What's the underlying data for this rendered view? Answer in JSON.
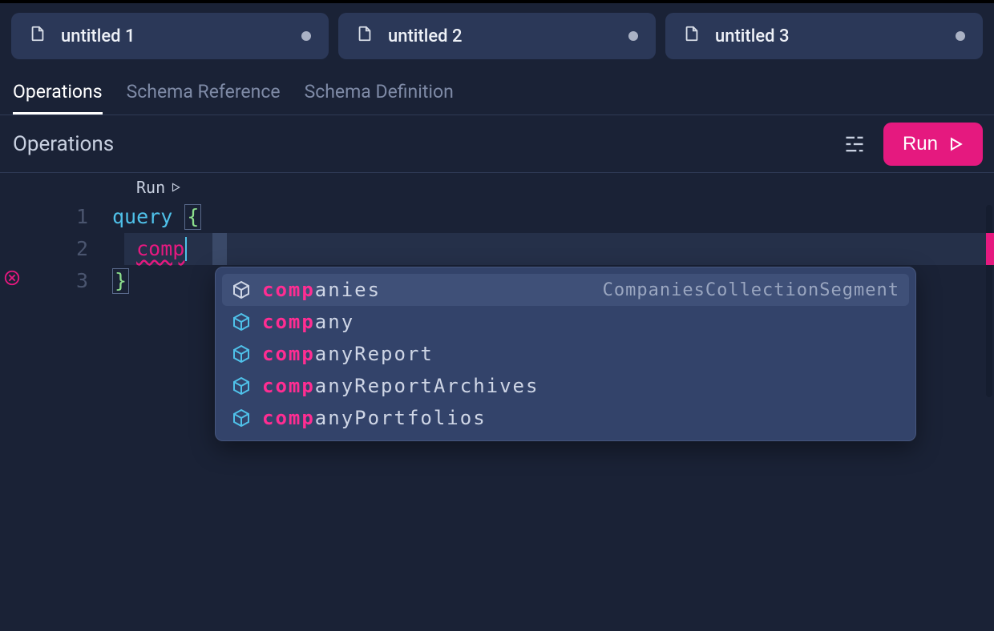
{
  "colors": {
    "accent": "#e5197f",
    "keyword": "#4fc1e9",
    "bg": "#1a2236"
  },
  "fileTabs": [
    {
      "label": "untitled 1",
      "dirty": true
    },
    {
      "label": "untitled 2",
      "dirty": true
    },
    {
      "label": "untitled 3",
      "dirty": true
    }
  ],
  "sectionTabs": {
    "items": [
      "Operations",
      "Schema Reference",
      "Schema Definition"
    ],
    "activeIndex": 0
  },
  "toolbar": {
    "title": "Operations",
    "runLabel": "Run",
    "formatIcon": "format-icon"
  },
  "editor": {
    "runHint": "Run",
    "lines": [
      {
        "n": 1,
        "tokens": [
          {
            "t": "query ",
            "cls": "kw"
          },
          {
            "t": "{",
            "cls": "brace brace-box"
          }
        ]
      },
      {
        "n": 2,
        "tokens": [
          {
            "t": "  ",
            "cls": ""
          },
          {
            "t": "comp",
            "cls": "ident ident-underline"
          }
        ],
        "error": true,
        "cursor": true
      },
      {
        "n": 3,
        "tokens": [
          {
            "t": "}",
            "cls": "brace brace-box"
          }
        ]
      }
    ]
  },
  "autocomplete": {
    "query": "comp",
    "items": [
      {
        "match": "comp",
        "rest": "anies",
        "detail": "CompaniesCollectionSegment",
        "iconColor": "#cfd6e6",
        "selected": true
      },
      {
        "match": "comp",
        "rest": "any",
        "detail": "",
        "iconColor": "#4fc1e9",
        "selected": false
      },
      {
        "match": "comp",
        "rest": "anyReport",
        "detail": "",
        "iconColor": "#4fc1e9",
        "selected": false
      },
      {
        "match": "comp",
        "rest": "anyReportArchives",
        "detail": "",
        "iconColor": "#4fc1e9",
        "selected": false
      },
      {
        "match": "comp",
        "rest": "anyPortfolios",
        "detail": "",
        "iconColor": "#4fc1e9",
        "selected": false
      }
    ]
  }
}
